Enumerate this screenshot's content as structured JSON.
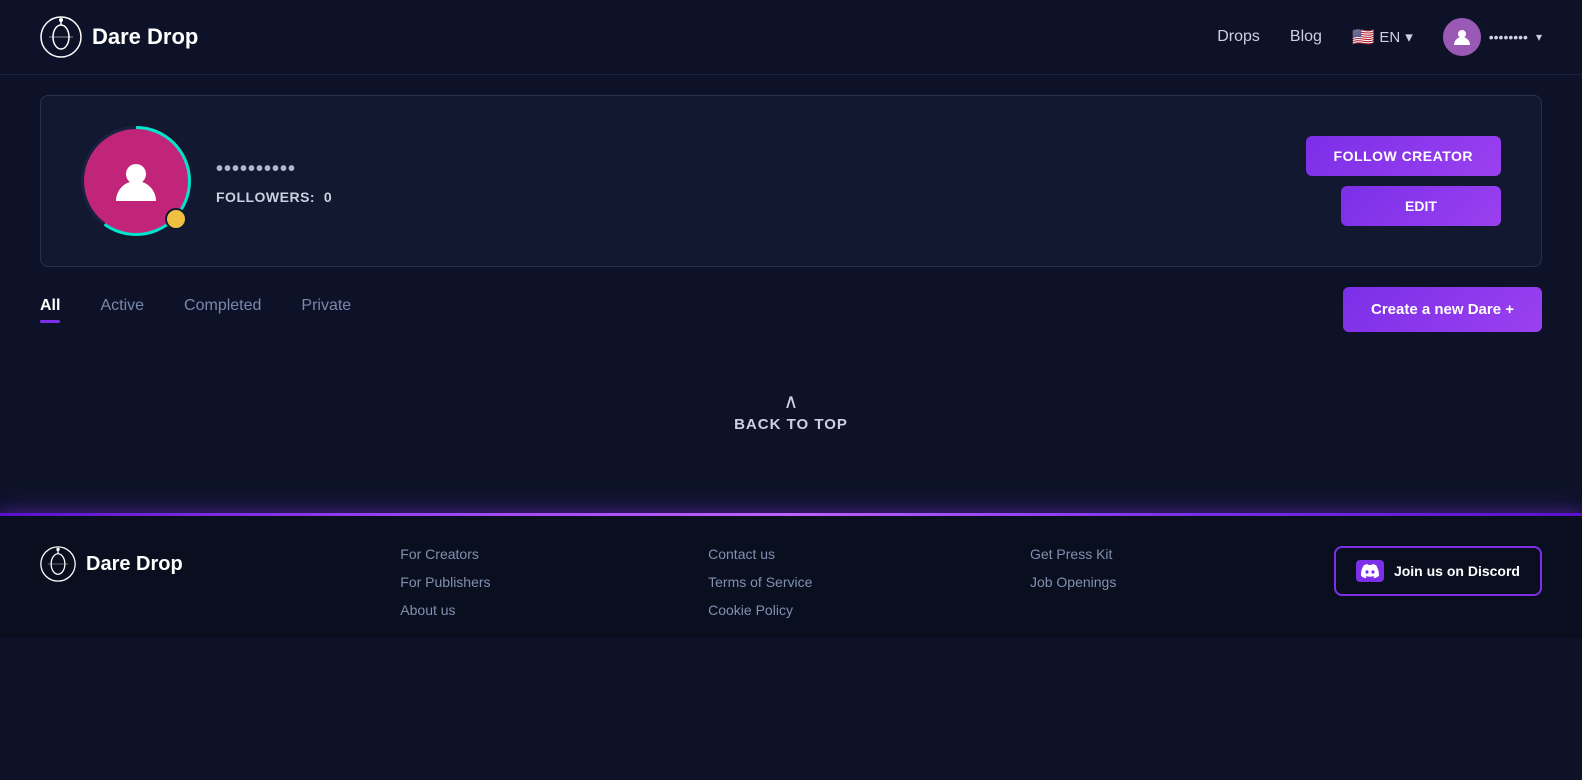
{
  "header": {
    "logo_text": "Dare Drop",
    "nav_drops": "Drops",
    "nav_blog": "Blog",
    "lang": "EN",
    "user_name": "••••••••",
    "chevron": "▾"
  },
  "profile": {
    "username": "••••••••••",
    "followers_label": "FOLLOWERS:",
    "followers_count": "0",
    "follow_btn": "FOLLOW CREATOR",
    "edit_btn": "EDIT"
  },
  "tabs": {
    "all_label": "All",
    "active_label": "Active",
    "completed_label": "Completed",
    "private_label": "Private",
    "create_dare_btn": "Create a new Dare +"
  },
  "back_to_top": {
    "chevron": "∧",
    "text": "BACK TO TOP"
  },
  "footer": {
    "logo_text": "Dare Drop",
    "col1": {
      "link1": "For Creators",
      "link2": "For Publishers",
      "link3": "About us"
    },
    "col2": {
      "link1": "Contact us",
      "link2": "Terms of Service",
      "link3": "Cookie Policy"
    },
    "col3": {
      "link1": "Get Press Kit",
      "link2": "Job Openings"
    },
    "discord_btn": "Join us on Discord"
  }
}
